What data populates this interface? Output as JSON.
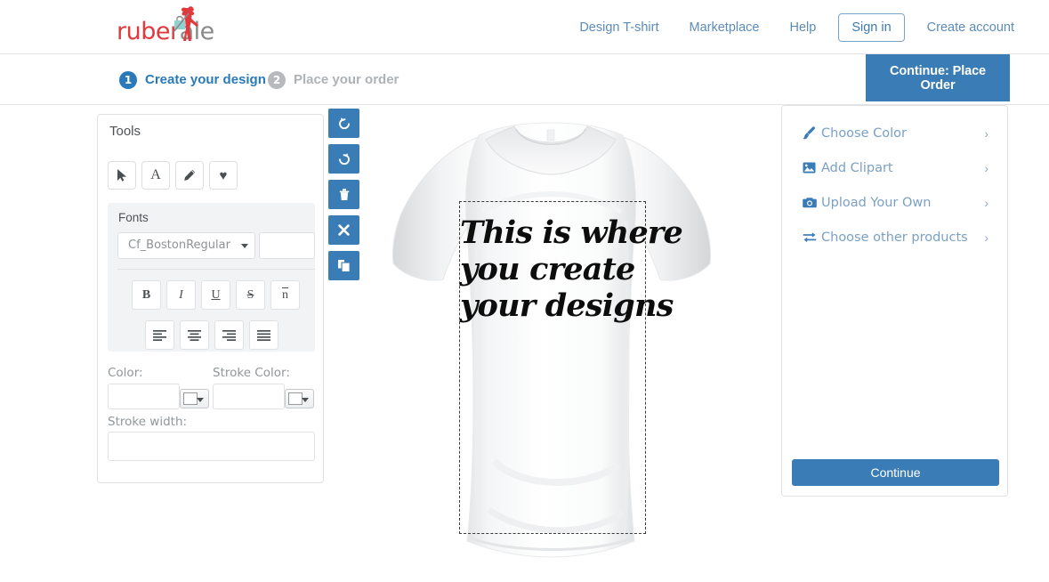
{
  "header": {
    "logo": {
      "brand_part1": "ruber",
      "brand_part2": "ale",
      "brand_full": "rubersale",
      "color_red": "#e0393e",
      "color_gray": "#8a8a8a"
    },
    "nav": [
      {
        "label": "Design T-shirt",
        "style": "link"
      },
      {
        "label": "Marketplace",
        "style": "link"
      },
      {
        "label": "Help",
        "style": "link"
      },
      {
        "label": "Sign in",
        "style": "boxed"
      },
      {
        "label": "Create account",
        "style": "link"
      }
    ]
  },
  "steps": {
    "step1": {
      "number": "1",
      "label": "Create your design",
      "active": true
    },
    "step2": {
      "number": "2",
      "label": "Place your order",
      "active": false
    },
    "place_order_button": "Continue: Place Order"
  },
  "tools_panel": {
    "title": "Tools",
    "tools": [
      {
        "name": "select-tool",
        "icon": "cursor-arrow-icon"
      },
      {
        "name": "text-tool",
        "icon": "letter-a-icon",
        "glyph": "A"
      },
      {
        "name": "draw-tool",
        "icon": "pencil-icon"
      },
      {
        "name": "shape-tool",
        "icon": "heart-icon",
        "glyph": "♥"
      }
    ],
    "fonts": {
      "title": "Fonts",
      "selected_font": "Cf_BostonRegular",
      "font_size_value": "",
      "font_size_placeholder": "",
      "styles": [
        {
          "name": "bold-button",
          "glyph": "B"
        },
        {
          "name": "italic-button",
          "glyph": "I"
        },
        {
          "name": "underline-button",
          "glyph": "U"
        },
        {
          "name": "strikethrough-button",
          "glyph": "S"
        },
        {
          "name": "overline-button",
          "glyph": "n"
        }
      ],
      "aligns": [
        {
          "name": "align-left-button"
        },
        {
          "name": "align-center-button"
        },
        {
          "name": "align-right-button"
        },
        {
          "name": "align-justify-button"
        }
      ]
    },
    "color_label": "Color:",
    "color_value": "",
    "stroke_color_label": "Stroke Color:",
    "stroke_color_value": "",
    "stroke_width_label": "Stroke width:",
    "stroke_width_value": ""
  },
  "canvas_toolbar": [
    {
      "name": "undo-button",
      "icon": "undo-icon"
    },
    {
      "name": "redo-button",
      "icon": "redo-icon"
    },
    {
      "name": "delete-button",
      "icon": "trash-icon"
    },
    {
      "name": "clear-button",
      "icon": "close-x-icon"
    },
    {
      "name": "duplicate-button",
      "icon": "copy-icon"
    }
  ],
  "canvas": {
    "product": "white-tshirt",
    "design_text_lines": [
      "This is where",
      "you create",
      "your designs"
    ],
    "design_text": "This is where you create your designs"
  },
  "options_panel": {
    "items": [
      {
        "label": "Choose Color",
        "icon": "brush-icon",
        "chevron": "›"
      },
      {
        "label": "Add Clipart",
        "icon": "image-icon",
        "chevron": "›"
      },
      {
        "label": "Upload Your Own",
        "icon": "camera-icon",
        "chevron": "›"
      },
      {
        "label": "Choose other products",
        "icon": "swap-arrows-icon",
        "chevron": "›"
      }
    ],
    "continue_button": "Continue"
  },
  "colors": {
    "primary_blue": "#3a7cb5",
    "link_blue": "#7ba0c4",
    "muted_gray": "#aeb3b7",
    "border_gray": "#dfe1e3"
  }
}
